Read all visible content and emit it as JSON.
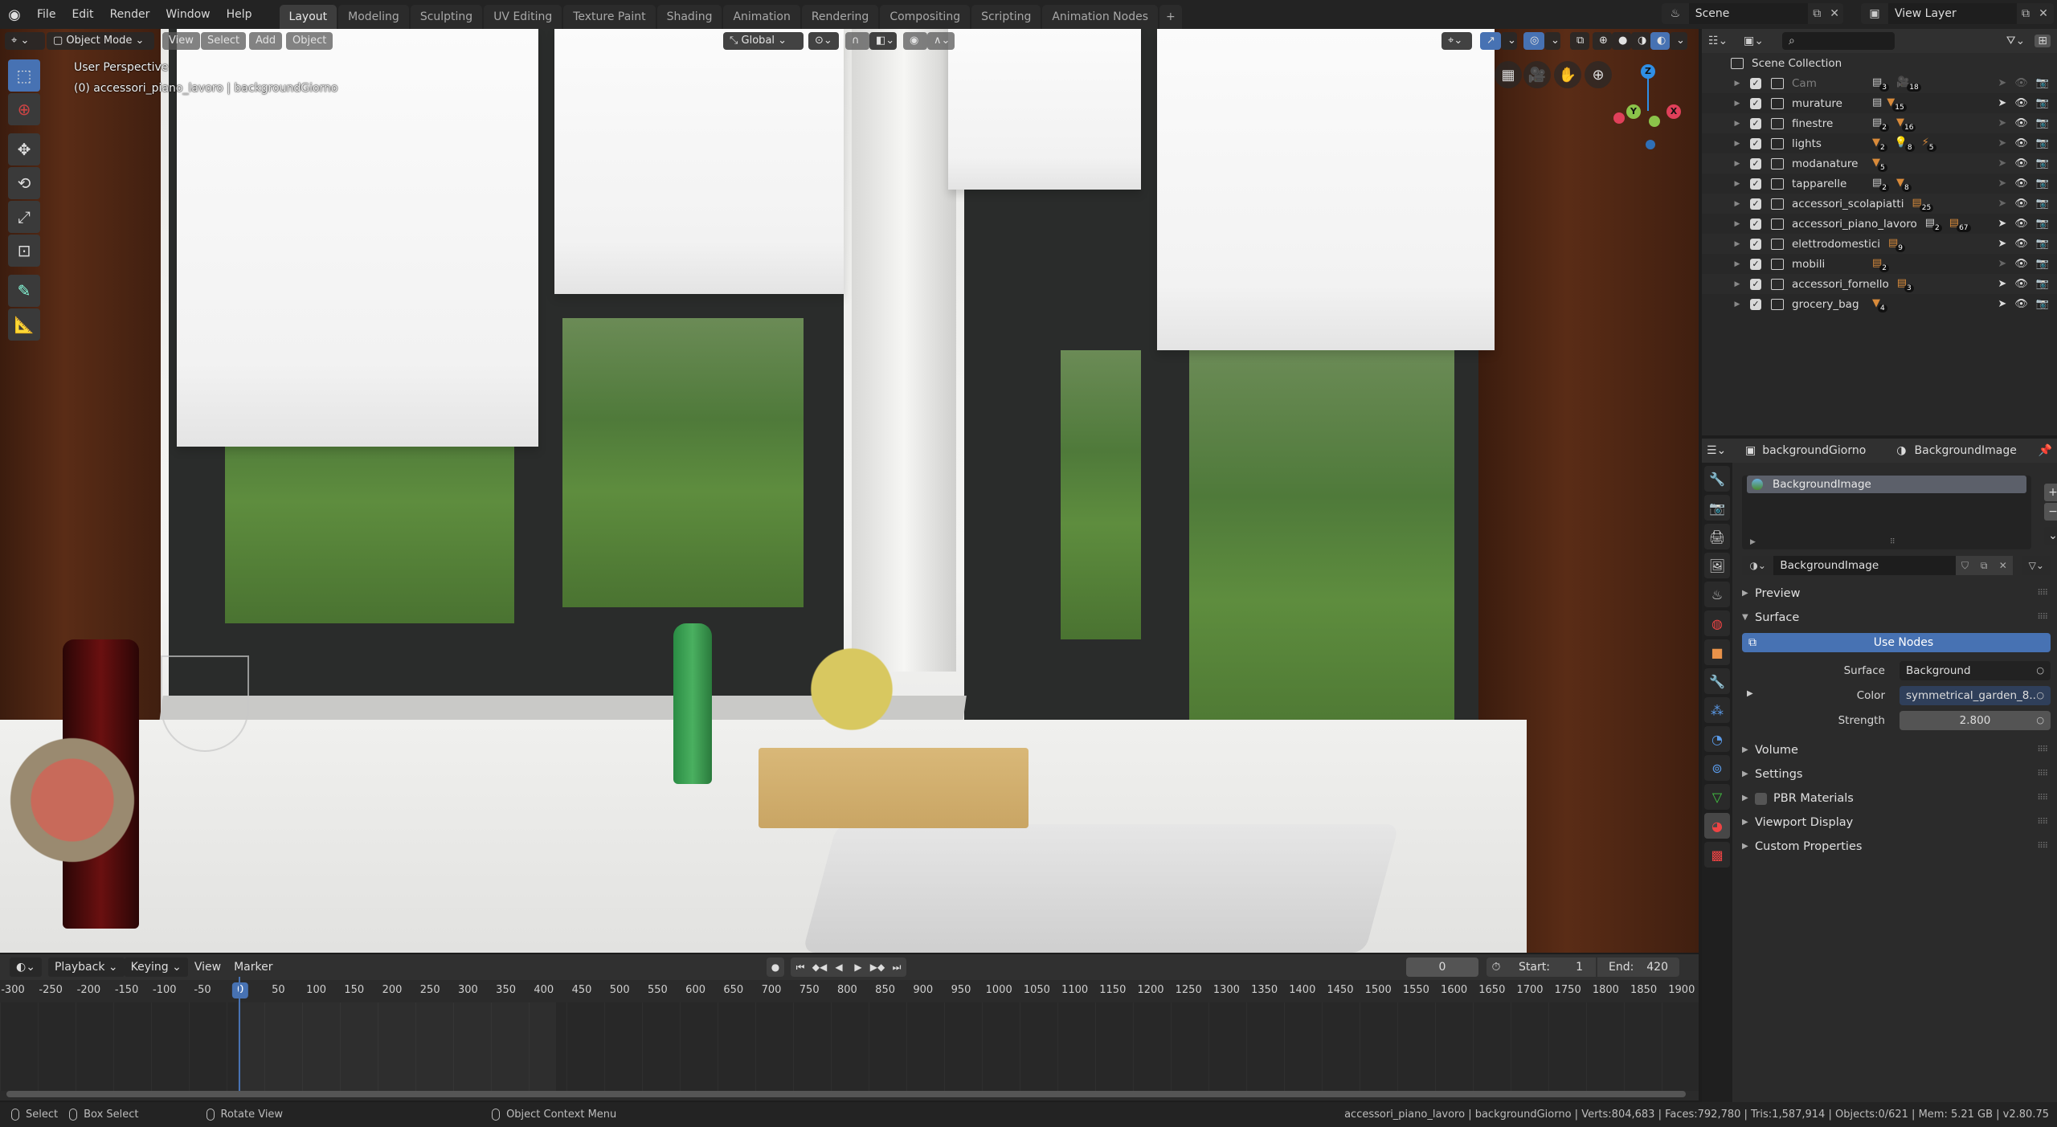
{
  "app": {
    "menus": [
      "File",
      "Edit",
      "Render",
      "Window",
      "Help"
    ]
  },
  "workspaces": {
    "tabs": [
      "Layout",
      "Modeling",
      "Sculpting",
      "UV Editing",
      "Texture Paint",
      "Shading",
      "Animation",
      "Rendering",
      "Compositing",
      "Scripting",
      "Animation Nodes"
    ],
    "active": "Layout",
    "add_label": "+"
  },
  "scene": {
    "name": "Scene",
    "view_layer": "View Layer"
  },
  "viewport": {
    "mode": "Object Mode",
    "menus": [
      "View",
      "Select",
      "Add",
      "Object"
    ],
    "transform_orientation": "Global",
    "view_name": "User Perspective",
    "active_info": "(0) accessori_piano_lavoro | backgroundGiorno",
    "gizmo_axes": {
      "z": "Z",
      "y": "Y",
      "x": "X"
    },
    "colors": {
      "accent": "#4772b3",
      "x_axis": "#e0405a",
      "y_axis": "#8bc34a",
      "z_axis": "#2f8fe6"
    }
  },
  "tools": [
    "select-box",
    "cursor",
    "move",
    "rotate",
    "scale",
    "transform",
    "annotate",
    "measure"
  ],
  "timeline": {
    "menus": [
      "Playback",
      "Keying",
      "View",
      "Marker"
    ],
    "current_frame": "0",
    "start_label": "Start:",
    "start": "1",
    "end_label": "End:",
    "end": "420",
    "ruler_ticks": [
      "-300",
      "-250",
      "-200",
      "-150",
      "-100",
      "-50",
      "0",
      "50",
      "100",
      "150",
      "200",
      "250",
      "300",
      "350",
      "400",
      "450",
      "500",
      "550",
      "600",
      "650",
      "700",
      "750",
      "800",
      "850",
      "900",
      "950",
      "1000",
      "1050",
      "1100",
      "1150",
      "1200",
      "1250",
      "1300",
      "1350",
      "1400",
      "1450",
      "1500",
      "1550",
      "1600",
      "1650",
      "1700",
      "1750",
      "1800",
      "1850",
      "1900"
    ],
    "playhead_tick": "0"
  },
  "statusbar": {
    "select": "Select",
    "box_select": "Box Select",
    "rotate_view": "Rotate View",
    "context_menu": "Object Context Menu",
    "stats": "accessori_piano_lavoro | backgroundGiorno | Verts:804,683 | Faces:792,780 | Tris:1,587,914 | Objects:0/621 | Mem: 5.21 GB | v2.80.75"
  },
  "outliner": {
    "root": "Scene Collection",
    "rows": [
      {
        "name": "Cam",
        "disabled": true,
        "badges": [
          {
            "icon": "collection",
            "count": "3",
            "grey": true
          },
          {
            "icon": "camera",
            "count": "18"
          }
        ],
        "selectable": false
      },
      {
        "name": "murature",
        "badges": [
          {
            "icon": "collection",
            "count": "",
            "grey": true
          },
          {
            "icon": "mesh",
            "count": "15"
          }
        ],
        "selectable": true
      },
      {
        "name": "finestre",
        "badges": [
          {
            "icon": "collection",
            "count": "2",
            "grey": true
          },
          {
            "icon": "mesh",
            "count": "16"
          }
        ],
        "selectable": false
      },
      {
        "name": "lights",
        "badges": [
          {
            "icon": "mesh",
            "count": "2"
          },
          {
            "icon": "light",
            "count": "8"
          },
          {
            "icon": "force",
            "count": "5"
          }
        ],
        "selectable": false
      },
      {
        "name": "modanature",
        "badges": [
          {
            "icon": "mesh",
            "count": "5"
          }
        ],
        "selectable": false
      },
      {
        "name": "tapparelle",
        "badges": [
          {
            "icon": "collection",
            "count": "2",
            "grey": true
          },
          {
            "icon": "mesh",
            "count": "8"
          }
        ],
        "selectable": false
      },
      {
        "name": "accessori_scolapiatti",
        "badges": [
          {
            "icon": "collection",
            "count": "25"
          }
        ],
        "selectable": false
      },
      {
        "name": "accessori_piano_lavoro",
        "badges": [
          {
            "icon": "collection",
            "count": "2",
            "grey": true
          },
          {
            "icon": "collection",
            "count": "67"
          }
        ],
        "selectable": true
      },
      {
        "name": "elettrodomestici",
        "badges": [
          {
            "icon": "collection",
            "count": "9"
          }
        ],
        "selectable": true
      },
      {
        "name": "mobili",
        "badges": [
          {
            "icon": "collection",
            "count": "2"
          }
        ],
        "selectable": false
      },
      {
        "name": "accessori_fornello",
        "badges": [
          {
            "icon": "collection",
            "count": "3"
          }
        ],
        "selectable": true
      },
      {
        "name": "grocery_bag",
        "badges": [
          {
            "icon": "mesh",
            "count": "4"
          }
        ],
        "selectable": true
      }
    ]
  },
  "properties": {
    "breadcrumb_object": "backgroundGiorno",
    "breadcrumb_world": "BackgroundImage",
    "slot_item": "BackgroundImage",
    "datablock_name": "BackgroundImage",
    "panels": {
      "preview": "Preview",
      "surface": "Surface",
      "use_nodes": "Use Nodes",
      "volume": "Volume",
      "settings": "Settings",
      "pbr": "PBR Materials",
      "viewport_display": "Viewport Display",
      "custom_props": "Custom Properties"
    },
    "fields": {
      "surface_label": "Surface",
      "surface_value": "Background",
      "color_label": "Color",
      "color_value": "symmetrical_garden_8..",
      "strength_label": "Strength",
      "strength_value": "2.800"
    }
  }
}
